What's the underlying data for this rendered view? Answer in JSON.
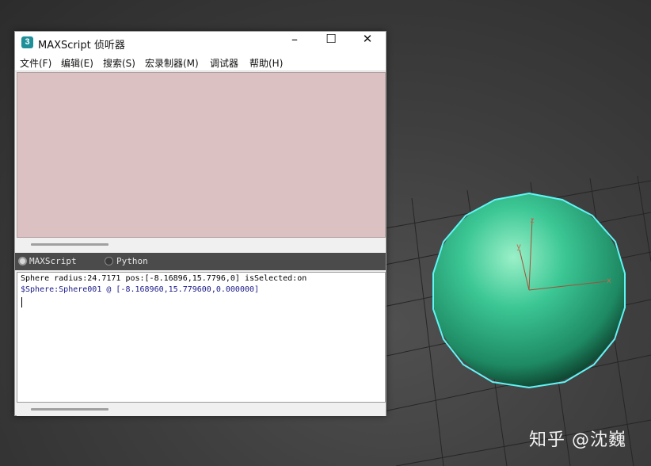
{
  "window": {
    "title": "MAXScript 侦听器",
    "icon_text": "3",
    "minimize_glyph": "–",
    "maximize_glyph": "☐",
    "close_glyph": "✕"
  },
  "menu": {
    "items": [
      "文件(F)",
      "编辑(E)",
      "搜索(S)",
      "宏录制器(M)",
      "调试器",
      "帮助(H)"
    ]
  },
  "language_tabs": [
    {
      "label": "MAXScript",
      "selected": true
    },
    {
      "label": "Python",
      "selected": false
    }
  ],
  "output": {
    "lines": [
      {
        "text": "Sphere radius:24.7171 pos:[-8.16896,15.7796,0] isSelected:on",
        "color": "#000000"
      },
      {
        "text": "$Sphere:Sphere001 @ [-8.168960,15.779600,0.000000]",
        "color": "#1a1a8a"
      }
    ]
  },
  "viewport": {
    "object_color": "#2fb88a",
    "selection_outline_color": "#5ff6f6",
    "axis_labels": {
      "x": "x",
      "y": "y",
      "z": "z"
    }
  },
  "watermark": "知乎 @沈巍"
}
